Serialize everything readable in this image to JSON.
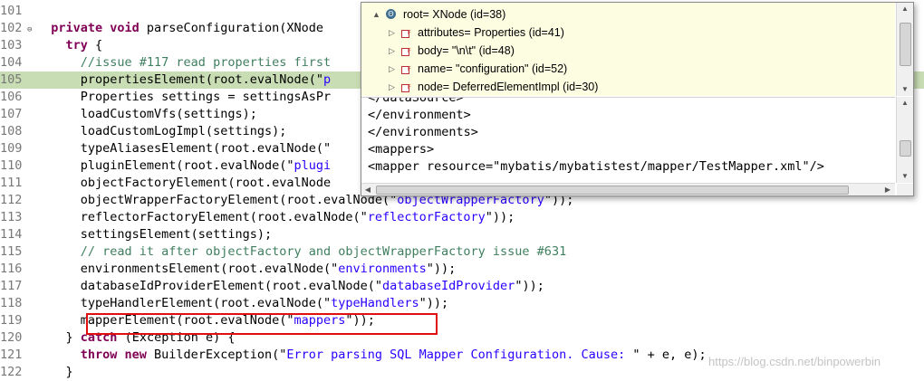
{
  "editor": {
    "lines": [
      {
        "num": "101",
        "fold": "",
        "hl": false,
        "tokens": []
      },
      {
        "num": "102",
        "fold": "⊖",
        "hl": false,
        "tokens": [
          {
            "c": "kw",
            "t": "  private "
          },
          {
            "c": "kw",
            "t": "void "
          },
          {
            "c": "",
            "t": "parseConfiguration(XNode"
          }
        ]
      },
      {
        "num": "103",
        "fold": "",
        "hl": false,
        "tokens": [
          {
            "c": "kw",
            "t": "    try "
          },
          {
            "c": "",
            "t": "{"
          }
        ]
      },
      {
        "num": "104",
        "fold": "",
        "hl": false,
        "tokens": [
          {
            "c": "cmt",
            "t": "      //issue #117 read properties first"
          }
        ]
      },
      {
        "num": "105",
        "fold": "",
        "hl": true,
        "tokens": [
          {
            "c": "",
            "t": "      propertiesElement(root.evalNode(\""
          },
          {
            "c": "str",
            "t": "p"
          }
        ]
      },
      {
        "num": "106",
        "fold": "",
        "hl": false,
        "tokens": [
          {
            "c": "",
            "t": "      Properties settings = settingsAsPr"
          }
        ]
      },
      {
        "num": "107",
        "fold": "",
        "hl": false,
        "tokens": [
          {
            "c": "",
            "t": "      loadCustomVfs(settings);"
          }
        ]
      },
      {
        "num": "108",
        "fold": "",
        "hl": false,
        "tokens": [
          {
            "c": "",
            "t": "      loadCustomLogImpl(settings);"
          }
        ]
      },
      {
        "num": "109",
        "fold": "",
        "hl": false,
        "tokens": [
          {
            "c": "",
            "t": "      typeAliasesElement(root.evalNode(\""
          }
        ]
      },
      {
        "num": "110",
        "fold": "",
        "hl": false,
        "tokens": [
          {
            "c": "",
            "t": "      pluginElement(root.evalNode(\""
          },
          {
            "c": "str",
            "t": "plugi"
          }
        ]
      },
      {
        "num": "111",
        "fold": "",
        "hl": false,
        "tokens": [
          {
            "c": "",
            "t": "      objectFactoryElement(root.evalNode"
          }
        ]
      },
      {
        "num": "112",
        "fold": "",
        "hl": false,
        "tokens": [
          {
            "c": "",
            "t": "      objectWrapperFactoryElement(root.evalNode(\""
          },
          {
            "c": "str",
            "t": "objectWrapperFactory"
          },
          {
            "c": "",
            "t": "\"));"
          }
        ]
      },
      {
        "num": "113",
        "fold": "",
        "hl": false,
        "tokens": [
          {
            "c": "",
            "t": "      reflectorFactoryElement(root.evalNode(\""
          },
          {
            "c": "str",
            "t": "reflectorFactory"
          },
          {
            "c": "",
            "t": "\"));"
          }
        ]
      },
      {
        "num": "114",
        "fold": "",
        "hl": false,
        "tokens": [
          {
            "c": "",
            "t": "      settingsElement(settings);"
          }
        ]
      },
      {
        "num": "115",
        "fold": "",
        "hl": false,
        "tokens": [
          {
            "c": "cmt",
            "t": "      // read it after objectFactory and objectWrapperFactory issue #631"
          }
        ]
      },
      {
        "num": "116",
        "fold": "",
        "hl": false,
        "tokens": [
          {
            "c": "",
            "t": "      environmentsElement(root.evalNode(\""
          },
          {
            "c": "str",
            "t": "environments"
          },
          {
            "c": "",
            "t": "\"));"
          }
        ]
      },
      {
        "num": "117",
        "fold": "",
        "hl": false,
        "tokens": [
          {
            "c": "",
            "t": "      databaseIdProviderElement(root.evalNode(\""
          },
          {
            "c": "str",
            "t": "databaseIdProvider"
          },
          {
            "c": "",
            "t": "\"));"
          }
        ]
      },
      {
        "num": "118",
        "fold": "",
        "hl": false,
        "tokens": [
          {
            "c": "",
            "t": "      typeHandlerElement(root.evalNode(\""
          },
          {
            "c": "str",
            "t": "typeHandlers"
          },
          {
            "c": "",
            "t": "\"));"
          }
        ]
      },
      {
        "num": "119",
        "fold": "",
        "hl": false,
        "tokens": [
          {
            "c": "",
            "t": "      mapperElement(root.evalNode(\""
          },
          {
            "c": "str",
            "t": "mappers"
          },
          {
            "c": "",
            "t": "\"));"
          }
        ]
      },
      {
        "num": "120",
        "fold": "",
        "hl": false,
        "tokens": [
          {
            "c": "",
            "t": "    } "
          },
          {
            "c": "kw",
            "t": "catch "
          },
          {
            "c": "",
            "t": "(Exception e) {"
          }
        ]
      },
      {
        "num": "121",
        "fold": "",
        "hl": false,
        "tokens": [
          {
            "c": "kw",
            "t": "      throw new "
          },
          {
            "c": "",
            "t": "BuilderException(\""
          },
          {
            "c": "str",
            "t": "Error parsing SQL Mapper Configuration. Cause: "
          },
          {
            "c": "",
            "t": "\" + e, e);"
          }
        ]
      },
      {
        "num": "122",
        "fold": "",
        "hl": false,
        "tokens": [
          {
            "c": "",
            "t": "    }"
          }
        ]
      }
    ]
  },
  "inspector": {
    "root": {
      "label": "root= XNode  (id=38)",
      "arrow": "▲",
      "icon": "Θ"
    },
    "children": [
      {
        "label": "attributes= Properties  (id=41)",
        "arrow": "▷"
      },
      {
        "label": "body= \"\\n\\t\"  (id=48)",
        "arrow": "▷"
      },
      {
        "label": "name= \"configuration\"  (id=52)",
        "arrow": "▷"
      },
      {
        "label": "node= DeferredElementImpl  (id=30)",
        "arrow": "▷"
      }
    ],
    "xml_lines": [
      "</dataSource>",
      "</environment>",
      "</environments>",
      "<mappers>",
      "<mapper resource=\"mybatis/mybatistest/mapper/TestMapper.xml\"/>"
    ]
  },
  "watermark": "https://blog.csdn.net/binpowerbin"
}
